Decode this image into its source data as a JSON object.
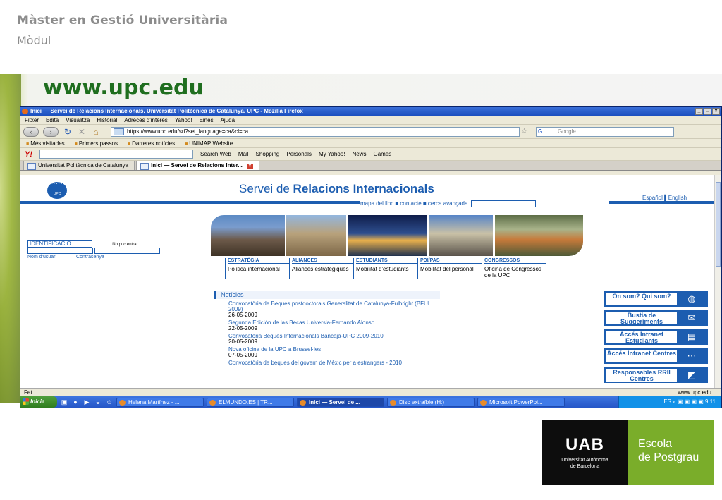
{
  "slide": {
    "title": "Màster en Gestió Universitària",
    "subtitle": "Mòdul",
    "url_heading": "www.upc.edu"
  },
  "browser": {
    "window_title": "Inici — Servei de Relacions Internacionals. Universitat Politècnica de Catalunya. UPC - Mozilla Firefox",
    "menu": [
      "Fitxer",
      "Edita",
      "Visualitza",
      "Historial",
      "Adreces d'interès",
      "Yahoo!",
      "Eines",
      "Ajuda"
    ],
    "address": "https://www.upc.edu/sri?set_language=ca&cl=ca",
    "search_placeholder": "Google",
    "bookmarks": [
      "Més visitades",
      "Primers passos",
      "Darreres notícies",
      "UNIMAP Website"
    ],
    "yahoo_toolbar": [
      "Search Web",
      "Mail",
      "Shopping",
      "Personals",
      "My Yahoo!",
      "News",
      "Games"
    ],
    "tabs": [
      {
        "label": "Universitat Politècnica de Catalunya",
        "active": false
      },
      {
        "label": "Inici — Servei de Relacions Inter...",
        "active": true
      }
    ],
    "status": "Fet",
    "status_right": "www.upc.edu"
  },
  "page": {
    "logo_text": "UPC",
    "title_light": "Servei de ",
    "title_bold": "Relacions Internacionals",
    "top_links": "mapa del lloc ■ contacte ■ cerca avançada",
    "languages": "Español ▌English",
    "identification": {
      "title": "IDENTIFICACIÓ",
      "cant_enter": "No puc entrar",
      "username": "Nom d'usuari",
      "password": "Contrasenya"
    },
    "pillars": [
      {
        "heading": "ESTRATÈGIA",
        "text": "Política internacional"
      },
      {
        "heading": "ALIANCES",
        "text": "Aliances estratègiques"
      },
      {
        "heading": "ESTUDIANTS",
        "text": "Mobilitat d'estudiants"
      },
      {
        "heading": "PDI/PAS",
        "text": "Mobilitat del personal"
      },
      {
        "heading": "CONGRESSOS",
        "text": "Oficina de Congressos de la UPC"
      }
    ],
    "news_title": "Notícies",
    "news": [
      {
        "title": "Convocatòria de Beques postdoctorals Generalitat de Catalunya-Fulbright (BFUL 2009)",
        "date": "26-05-2009"
      },
      {
        "title": "Segunda Edición de las Becas Universia-Fernando Alonso",
        "date": "22-05-2009"
      },
      {
        "title": "Convocatòria Beques Internacionals Bancaja-UPC 2009-2010",
        "date": "20-05-2009"
      },
      {
        "title": "Nova oficina de la UPC a Brussel·les",
        "date": "07-05-2009"
      },
      {
        "title": "Convocatòria de beques del govern de Mèxic per a estrangers - 2010",
        "date": ""
      }
    ],
    "side_buttons": [
      {
        "label": "On som? Qui som?",
        "icon": "globe-icon",
        "glyph": "◍"
      },
      {
        "label": "Bustia de Suggeriments",
        "icon": "envelope-icon",
        "glyph": "✉"
      },
      {
        "label": "Accés Intranet Estudiants",
        "icon": "book-icon",
        "glyph": "▤"
      },
      {
        "label": "Accés Intranet Centres",
        "icon": "network-icon",
        "glyph": "⋯"
      },
      {
        "label": "Responsables RRII Centres",
        "icon": "map-icon",
        "glyph": "◩"
      }
    ]
  },
  "taskbar": {
    "start": "Inicia",
    "tasks": [
      {
        "label": "Helena Martínez - ...",
        "active": false
      },
      {
        "label": "ELMUNDO.ES | TR...",
        "active": false
      },
      {
        "label": "Inici — Servei de ...",
        "active": true
      },
      {
        "label": "Disc extraïble (H:)",
        "active": false
      },
      {
        "label": "Microsoft PowerPoi...",
        "active": false
      }
    ],
    "tray_lang": "ES",
    "clock": "9:11"
  },
  "logos": {
    "uab_name": "UAB",
    "uab_sub1": "Universitat Autònoma",
    "uab_sub2": "de Barcelona",
    "escola_line1": "Escola",
    "escola_line2": "de Postgrau"
  }
}
